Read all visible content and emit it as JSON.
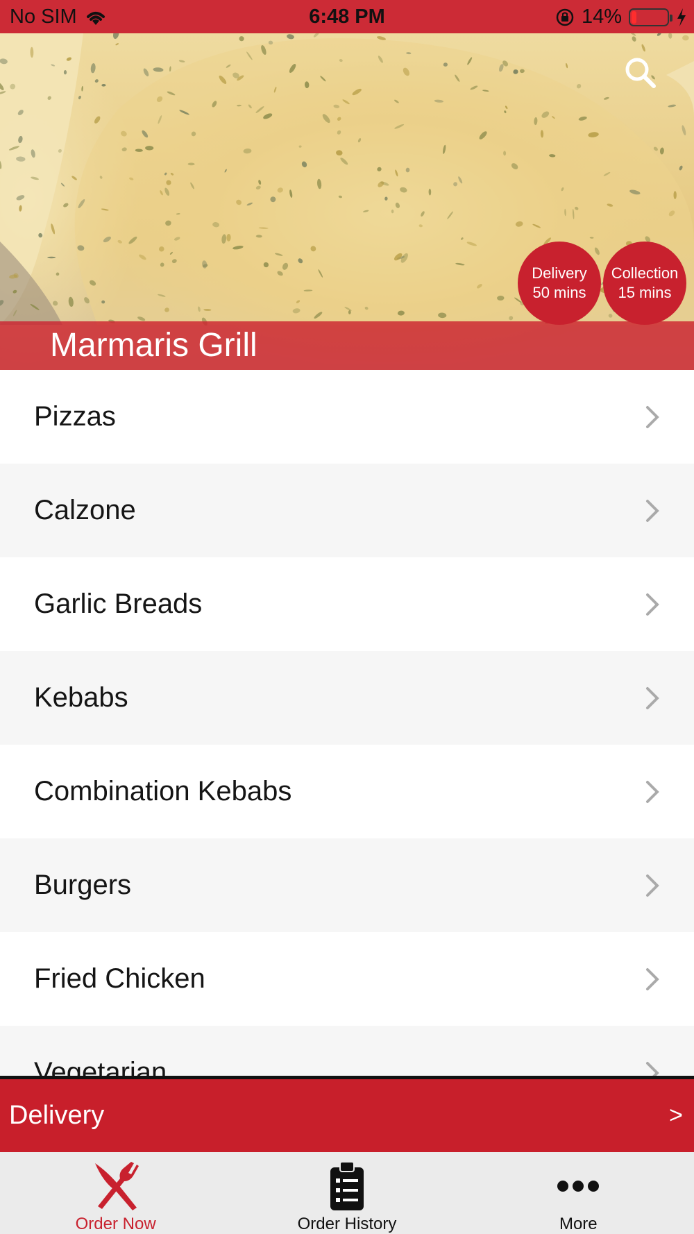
{
  "status_bar": {
    "carrier": "No SIM",
    "time": "6:48 PM",
    "battery_percent": "14%",
    "battery_level": 0.14,
    "icons": [
      "wifi-icon",
      "orientation-lock-icon",
      "battery-icon",
      "charging-icon"
    ]
  },
  "hero": {
    "restaurant_name": "Marmaris Grill",
    "search_icon": "search-icon",
    "delivery_badge": {
      "label": "Delivery",
      "time": "50 mins"
    },
    "collection_badge": {
      "label": "Collection",
      "time": "15 mins"
    }
  },
  "menu": {
    "categories": [
      {
        "label": "Pizzas"
      },
      {
        "label": "Calzone"
      },
      {
        "label": "Garlic Breads"
      },
      {
        "label": "Kebabs"
      },
      {
        "label": "Combination Kebabs"
      },
      {
        "label": "Burgers"
      },
      {
        "label": "Fried Chicken"
      },
      {
        "label": "Vegetarian"
      }
    ]
  },
  "delivery_bar": {
    "label": "Delivery",
    "arrow": ">"
  },
  "tab_bar": {
    "tabs": [
      {
        "label": "Order Now",
        "icon": "fork-knife-icon",
        "active": true
      },
      {
        "label": "Order History",
        "icon": "clipboard-icon",
        "active": false
      },
      {
        "label": "More",
        "icon": "more-dots-icon",
        "active": false
      }
    ]
  },
  "colors": {
    "brand_red": "#c8212e",
    "status_bar_red": "#cc2b36",
    "tab_bar_bg": "#ebebeb"
  }
}
